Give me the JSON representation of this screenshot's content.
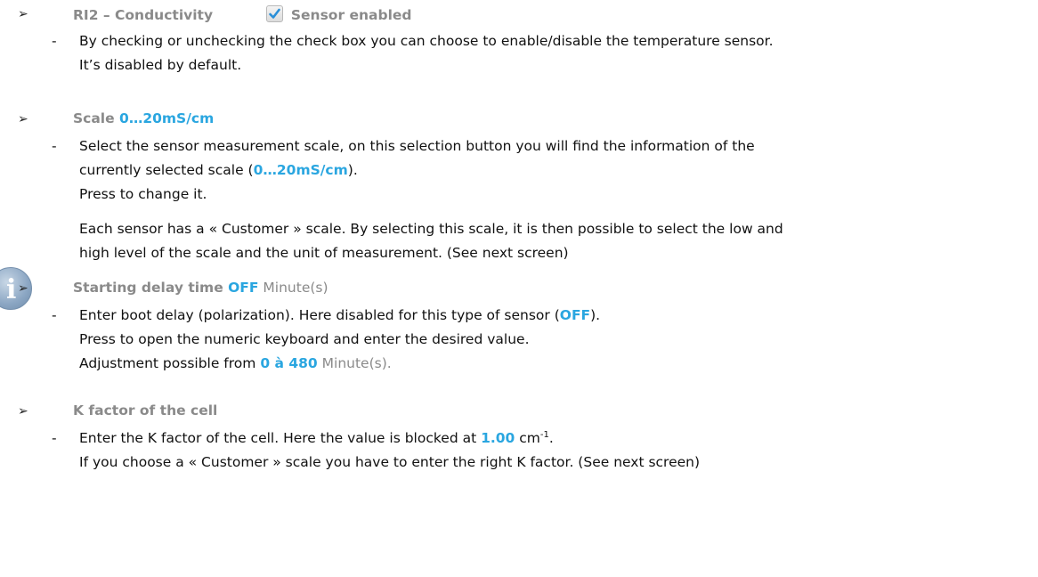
{
  "s1": {
    "title": "RI2 – Conductivity",
    "checkbox_label": "Sensor enabled",
    "line1": "By checking or unchecking the check box you can choose to enable/disable the temperature sensor.",
    "line2": "It’s disabled by default."
  },
  "s2": {
    "title_a": "Scale ",
    "title_b": "0…20mS/cm",
    "line1": "Select the sensor measurement scale, on this selection button you will find the information of the",
    "line2_a": "currently selected scale (",
    "line2_b": "0…20mS/cm",
    "line2_c": ").",
    "line3": "Press to change it."
  },
  "info": {
    "line1": "Each sensor has a « Customer » scale. By selecting this scale, it is then possible to select the low and",
    "line2": "high level of the scale and the unit of measurement. (See next screen)"
  },
  "s3": {
    "title_a": "Starting delay time ",
    "title_b": "OFF",
    "title_c": " Minute(s)",
    "line1_a": "Enter boot delay (polarization). Here disabled for this type of sensor (",
    "line1_b": "OFF",
    "line1_c": ").",
    "line2": "Press to open the numeric keyboard and enter the desired value.",
    "line3_a": "Adjustment possible from ",
    "line3_b": "0 à 480",
    "line3_c": " Minute(s)."
  },
  "s4": {
    "title": "K factor of the cell",
    "line1_a": "Enter the K factor of the cell. Here the value is blocked at ",
    "line1_b": "1.00",
    "line1_c": " cm",
    "line1_sup": "-1",
    "line1_d": ".",
    "line2": "If you choose a « Customer » scale you have to enter the right K factor. (See next screen)"
  },
  "icons": {
    "arrow": "➢",
    "dash": "-",
    "info": "i"
  }
}
